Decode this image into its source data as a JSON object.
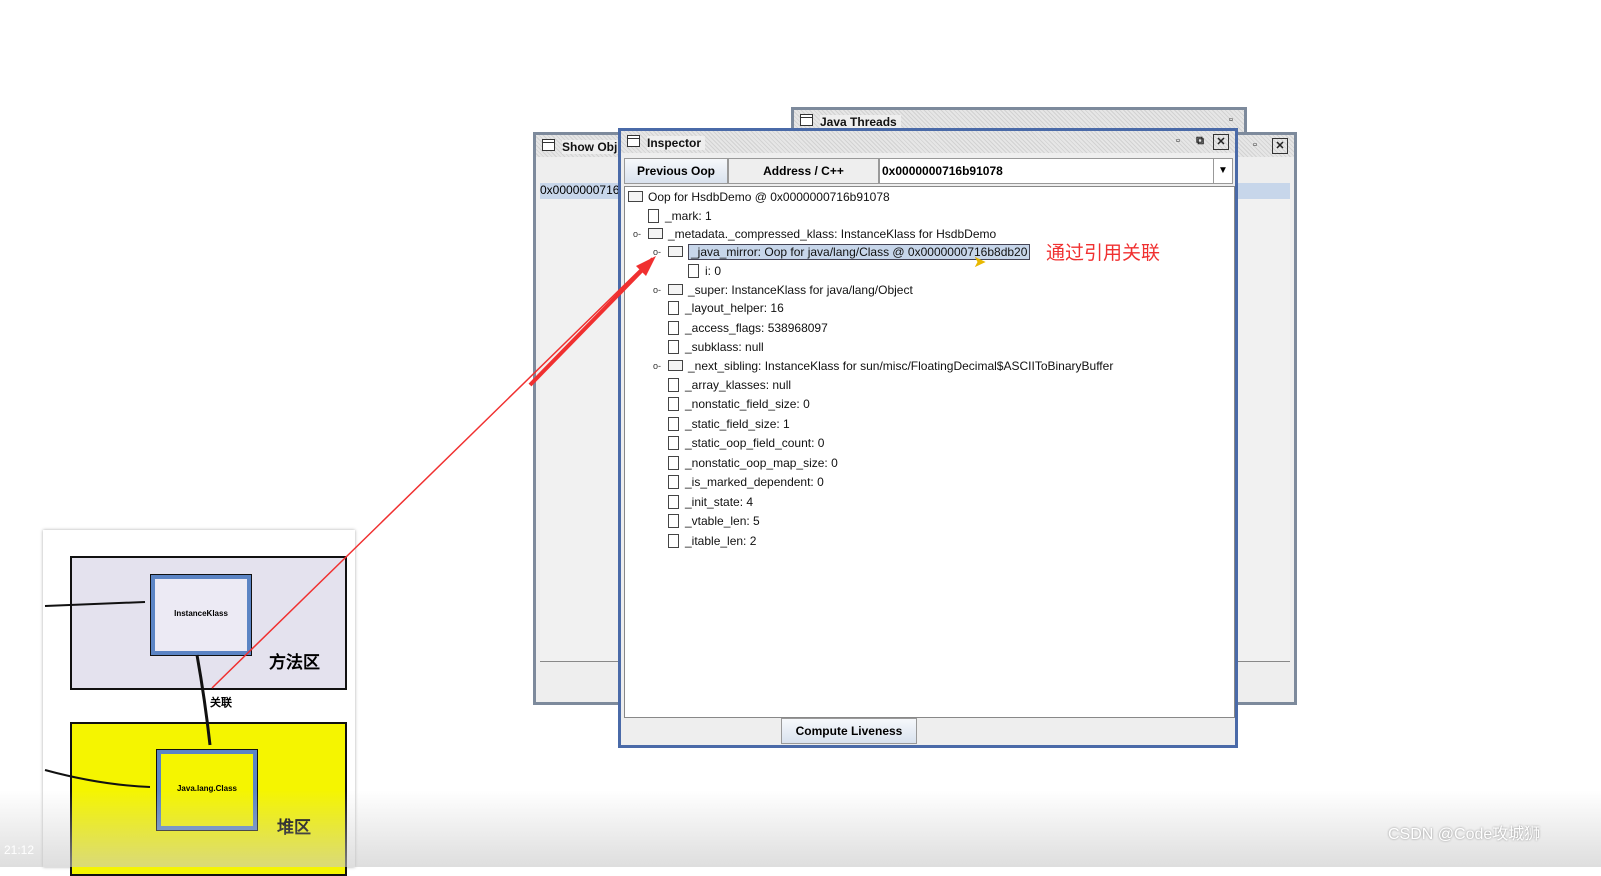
{
  "windows": {
    "java_threads": {
      "title": "Java Threads"
    },
    "show_object": {
      "title": "Show Obj",
      "address": "0x0000000716"
    },
    "inspector": {
      "title": "Inspector",
      "previous_oop": "Previous Oop",
      "address_label": "Address / C++ Expression:",
      "address_value": "0x0000000716b91078",
      "compute_liveness": "Compute Liveness",
      "tree": [
        {
          "text": "Oop for HsdbDemo @ 0x0000000716b91078",
          "level": 0,
          "type": "folder"
        },
        {
          "text": "_mark: 1",
          "level": 1,
          "type": "leaf"
        },
        {
          "text": "_metadata._compressed_klass: InstanceKlass for HsdbDemo",
          "level": 1,
          "type": "folder"
        },
        {
          "text": "_java_mirror: Oop for java/lang/Class @ 0x0000000716b8db20",
          "level": 2,
          "type": "folder",
          "selected": true
        },
        {
          "text": "i: 0",
          "level": 3,
          "type": "leaf"
        },
        {
          "text": "_super: InstanceKlass for java/lang/Object",
          "level": 2,
          "type": "folder"
        },
        {
          "text": "_layout_helper: 16",
          "level": 2,
          "type": "leaf"
        },
        {
          "text": "_access_flags: 538968097",
          "level": 2,
          "type": "leaf"
        },
        {
          "text": "_subklass: null",
          "level": 2,
          "type": "leaf"
        },
        {
          "text": "_next_sibling: InstanceKlass for sun/misc/FloatingDecimal$ASCIIToBinaryBuffer",
          "level": 2,
          "type": "folder"
        },
        {
          "text": "_array_klasses: null",
          "level": 2,
          "type": "leaf"
        },
        {
          "text": "_nonstatic_field_size: 0",
          "level": 2,
          "type": "leaf"
        },
        {
          "text": "_static_field_size: 1",
          "level": 2,
          "type": "leaf"
        },
        {
          "text": "_static_oop_field_count: 0",
          "level": 2,
          "type": "leaf"
        },
        {
          "text": "_nonstatic_oop_map_size: 0",
          "level": 2,
          "type": "leaf"
        },
        {
          "text": "_is_marked_dependent: 0",
          "level": 2,
          "type": "leaf"
        },
        {
          "text": "_init_state: 4",
          "level": 2,
          "type": "leaf"
        },
        {
          "text": "_vtable_len: 5",
          "level": 2,
          "type": "leaf"
        },
        {
          "text": "_itable_len: 2",
          "level": 2,
          "type": "leaf"
        }
      ]
    }
  },
  "annotation": "通过引用关联",
  "diagram": {
    "method_area": "方法区",
    "heap": "堆区",
    "instance_klass": "InstanceKlass",
    "java_lang_class": "Java.lang.Class",
    "link": "关联"
  },
  "video_time": "21:12",
  "watermark": "CSDN @Code攻城狮",
  "colors": {
    "arrow": "#f03030",
    "heap": "#f5f500",
    "method_area": "#e4e2ee",
    "selection": "#c7d6ea"
  }
}
